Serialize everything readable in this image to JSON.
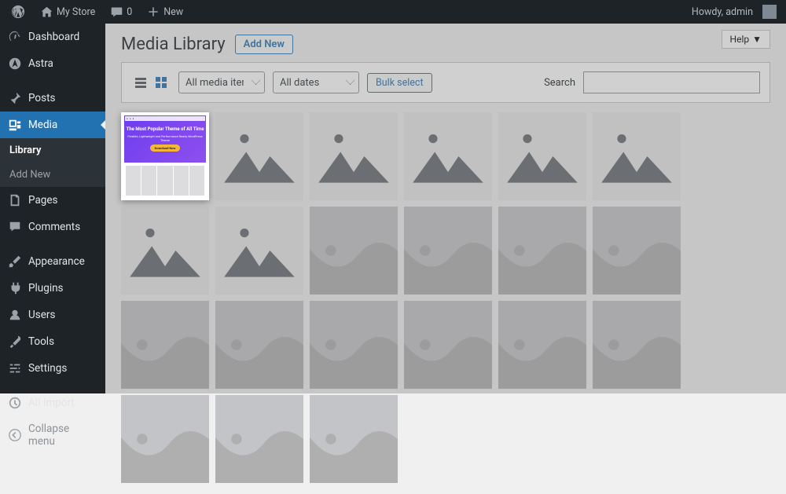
{
  "toolbar": {
    "site_name": "My Store",
    "comments_count": "0",
    "new_label": "New",
    "howdy_label": "Howdy, admin"
  },
  "sidebar": {
    "items": [
      {
        "id": "dashboard",
        "label": "Dashboard"
      },
      {
        "id": "astra",
        "label": "Astra"
      },
      {
        "id": "posts",
        "label": "Posts"
      },
      {
        "id": "media",
        "label": "Media"
      },
      {
        "id": "pages",
        "label": "Pages"
      },
      {
        "id": "comments",
        "label": "Comments"
      },
      {
        "id": "appearance",
        "label": "Appearance"
      },
      {
        "id": "plugins",
        "label": "Plugins"
      },
      {
        "id": "users",
        "label": "Users"
      },
      {
        "id": "tools",
        "label": "Tools"
      },
      {
        "id": "settings",
        "label": "Settings"
      },
      {
        "id": "allimport",
        "label": "All Import"
      }
    ],
    "media_sub": {
      "library": "Library",
      "addnew": "Add New"
    },
    "collapse": "Collapse menu"
  },
  "page": {
    "title": "Media Library",
    "add_new": "Add New",
    "help": "Help"
  },
  "filters": {
    "media_types": "All media items",
    "dates": "All dates",
    "bulk_select": "Bulk select",
    "search_label": "Search"
  },
  "featured": {
    "heading": "The Most Popular Theme of All Time",
    "subtitle": "Flexible, Lightweight and Performance Ready WordPress Theme",
    "button": "Download Now"
  }
}
